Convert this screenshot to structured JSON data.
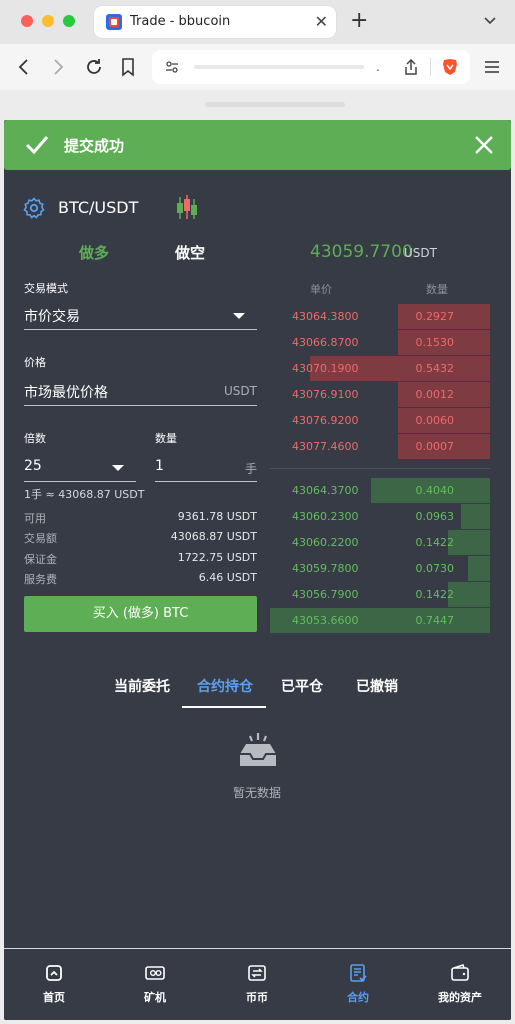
{
  "browser": {
    "tab_title": "Trade - bbucoin",
    "tab_close": "✕",
    "new_tab": "+",
    "url_dot": "."
  },
  "toast": {
    "message": "提交成功"
  },
  "pair": {
    "name": "BTC/USDT"
  },
  "sides": {
    "long": "做多",
    "short": "做空"
  },
  "ticker": {
    "price": "43059.7700",
    "unit": "USDT"
  },
  "form": {
    "mode_label": "交易模式",
    "mode_value": "市价交易",
    "price_label": "价格",
    "price_value": "市场最优价格",
    "price_unit": "USDT",
    "leverage_label": "倍数",
    "leverage_value": "25",
    "qty_label": "数量",
    "qty_value": "1",
    "qty_unit": "手",
    "hint": "1手 ≈ 43068.87 USDT",
    "info": [
      {
        "k": "可用",
        "v": "9361.78 USDT"
      },
      {
        "k": "交易额",
        "v": "43068.87 USDT"
      },
      {
        "k": "保证金",
        "v": "1722.75 USDT"
      },
      {
        "k": "服务费",
        "v": "6.46 USDT"
      }
    ],
    "submit": "买入 (做多) BTC"
  },
  "orderbook": {
    "price_header": "单价",
    "qty_header": "数量",
    "asks": [
      {
        "price": "43064.3800",
        "qty": "0.2927",
        "depth": 0.42
      },
      {
        "price": "43066.8700",
        "qty": "0.1530",
        "depth": 0.42
      },
      {
        "price": "43070.1900",
        "qty": "0.5432",
        "depth": 0.82
      },
      {
        "price": "43076.9100",
        "qty": "0.0012",
        "depth": 0.42
      },
      {
        "price": "43076.9200",
        "qty": "0.0060",
        "depth": 0.42
      },
      {
        "price": "43077.4600",
        "qty": "0.0007",
        "depth": 0.42
      }
    ],
    "bids": [
      {
        "price": "43064.3700",
        "qty": "0.4040",
        "depth": 0.54
      },
      {
        "price": "43060.2300",
        "qty": "0.0963",
        "depth": 0.13
      },
      {
        "price": "43060.2200",
        "qty": "0.1422",
        "depth": 0.19
      },
      {
        "price": "43059.7800",
        "qty": "0.0730",
        "depth": 0.1
      },
      {
        "price": "43056.7900",
        "qty": "0.1422",
        "depth": 0.19
      },
      {
        "price": "43053.6600",
        "qty": "0.7447",
        "depth": 1.0
      }
    ]
  },
  "order_tabs": [
    {
      "label": "当前委托",
      "active": false
    },
    {
      "label": "合约持仓",
      "active": true
    },
    {
      "label": "已平仓",
      "active": false
    },
    {
      "label": "已撤销",
      "active": false
    }
  ],
  "empty_text": "暂无数据",
  "nav": [
    {
      "label": "首页",
      "icon": "home-icon",
      "active": false
    },
    {
      "label": "矿机",
      "icon": "miner-icon",
      "active": false
    },
    {
      "label": "币币",
      "icon": "exchange-icon",
      "active": false
    },
    {
      "label": "合约",
      "icon": "contract-icon",
      "active": true
    },
    {
      "label": "我的资产",
      "icon": "wallet-icon",
      "active": false
    }
  ],
  "colors": {
    "accent_green": "#5eae55",
    "ask_red": "#ef6a6a",
    "active_blue": "#5aa0f0",
    "app_bg": "#373b46"
  }
}
